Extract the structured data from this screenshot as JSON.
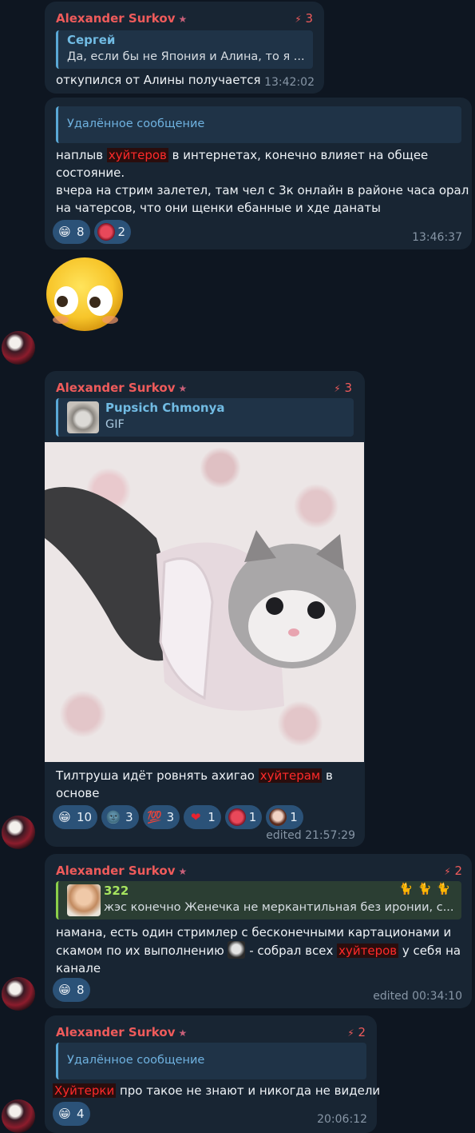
{
  "messages": [
    {
      "sender": "Alexander Surkov",
      "rank": "3",
      "reply_name": "Сергей",
      "reply_text": "Да, если бы не Япония и Алина, то я ...",
      "text": "откупился от Алины получается",
      "time": "13:42:02"
    },
    {
      "reply_deleted": "Удалённое сообщение",
      "line1_pre": "наплыв ",
      "line1_spoiler": "хуйтеров",
      "line1_post": " в интернетах, конечно влияет на общее",
      "line2": "состояние.",
      "line3": "вчера на стрим залетел, там чел с 3к онлайн в районе часа орал",
      "line4": "на чатерсов, что они щенки ебанные и хде данаты",
      "reactions": [
        {
          "icon": "grin-emoji",
          "glyph": "😁",
          "count": "8"
        },
        {
          "icon": "red-face-sticker",
          "glyph": "",
          "count": "2"
        }
      ],
      "time": "13:46:37"
    },
    {
      "sticker": "flushed-face-sticker"
    },
    {
      "sender": "Alexander Surkov",
      "rank": "3",
      "reply_name": "Pupsich Chmonya",
      "reply_text": "GIF",
      "image": "kitten-in-frilly-dress-gif",
      "line1_pre": "Тилтруша идёт ровнять ахигао ",
      "line1_spoiler": "хуйтерам",
      "line1_post": " в",
      "line2": "основе",
      "reactions": [
        {
          "icon": "grin-emoji",
          "glyph": "😁",
          "count": "10"
        },
        {
          "icon": "moon-face-emoji",
          "glyph": "🌚",
          "count": "3"
        },
        {
          "icon": "hundred-emoji",
          "glyph": "💯",
          "count": "3"
        },
        {
          "icon": "heart-emoji",
          "glyph": "❤",
          "count": "1"
        },
        {
          "icon": "red-face-sticker",
          "glyph": "",
          "count": "1"
        },
        {
          "icon": "portrait-sticker",
          "glyph": "",
          "count": "1"
        }
      ],
      "time": "edited 21:57:29"
    },
    {
      "sender": "Alexander Surkov",
      "rank": "2",
      "reply_name": "322",
      "reply_text": "жэс конечно Женечка не меркантильная без иронии, с...",
      "line1": "намана, есть один стримлер с бесконечными картационами и",
      "line2_pre": "скамом по их выполнению ",
      "line2_mid": " - собрал всех ",
      "line2_spoiler": "хуйтеров",
      "line2_post": " у себя на",
      "line3": "канале",
      "reactions": [
        {
          "icon": "grin-emoji",
          "glyph": "😁",
          "count": "8"
        }
      ],
      "time": "edited 00:34:10"
    },
    {
      "sender": "Alexander Surkov",
      "rank": "2",
      "reply_deleted": "Удалённое сообщение",
      "line1_spoiler": "Хуйтерки",
      "line1_post": " про такое не знают и никогда не видели",
      "reactions": [
        {
          "icon": "grin-emoji",
          "glyph": "😁",
          "count": "4"
        }
      ],
      "time": "20:06:12"
    }
  ],
  "colors": {
    "background": "#0e1621",
    "bubble": "#182533",
    "sender": "#ef5b5b",
    "quote_accent": "#5aa8d6",
    "reaction": "#2b5278"
  }
}
